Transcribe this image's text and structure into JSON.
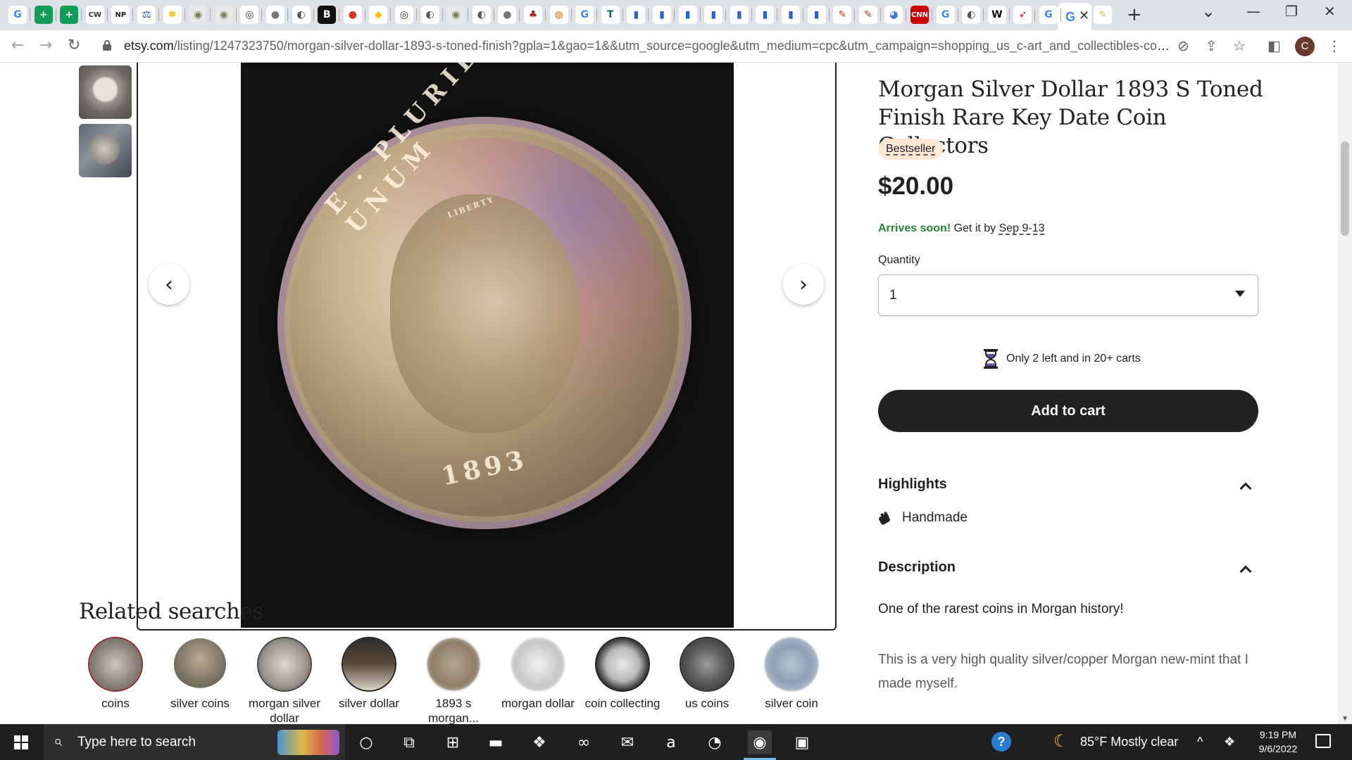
{
  "browser": {
    "favicons": [
      {
        "glyph": "G",
        "bg": "#ffffff",
        "fg": "#4285f4"
      },
      {
        "glyph": "+",
        "bg": "#0f9d58",
        "fg": "#ffffff"
      },
      {
        "glyph": "+",
        "bg": "#0f9d58",
        "fg": "#ffffff"
      },
      {
        "glyph": "CW",
        "bg": "#ffffff",
        "fg": "#333333"
      },
      {
        "glyph": "NP",
        "bg": "#ffffff",
        "fg": "#222222"
      },
      {
        "glyph": "⚖",
        "bg": "#ffffff",
        "fg": "#1a4fa0"
      },
      {
        "glyph": "✱",
        "bg": "#ffffff",
        "fg": "#ffc220"
      },
      {
        "glyph": "◉",
        "bg": "#e8e8e8",
        "fg": "#7a7a5a"
      },
      {
        "glyph": "◉",
        "bg": "#e8e8e8",
        "fg": "#7a7a5a"
      },
      {
        "glyph": "◎",
        "bg": "#ffffff",
        "fg": "#333333"
      },
      {
        "glyph": "●",
        "bg": "#ffffff",
        "fg": "#777777"
      },
      {
        "glyph": "◐",
        "bg": "#ffffff",
        "fg": "#555555"
      },
      {
        "glyph": "B",
        "bg": "#111111",
        "fg": "#ffffff"
      },
      {
        "glyph": "●",
        "bg": "#ffffff",
        "fg": "#d93025"
      },
      {
        "glyph": "◆",
        "bg": "#ffffff",
        "fg": "#f4c20d"
      },
      {
        "glyph": "◎",
        "bg": "#ffffff",
        "fg": "#333333"
      },
      {
        "glyph": "◐",
        "bg": "#ffffff",
        "fg": "#555555"
      },
      {
        "glyph": "◉",
        "bg": "#e8e8e8",
        "fg": "#7a7a5a"
      },
      {
        "glyph": "◐",
        "bg": "#ffffff",
        "fg": "#555555"
      },
      {
        "glyph": "●",
        "bg": "#ffffff",
        "fg": "#777777"
      },
      {
        "glyph": "♣",
        "bg": "#ffffff",
        "fg": "#b22222"
      },
      {
        "glyph": "◍",
        "bg": "#ffffff",
        "fg": "#e07b39"
      },
      {
        "glyph": "G",
        "bg": "#ffffff",
        "fg": "#4285f4"
      },
      {
        "glyph": "T",
        "bg": "#ffffff",
        "fg": "#0f6e5a"
      },
      {
        "glyph": "▮",
        "bg": "#ffffff",
        "fg": "#2b5fd9"
      },
      {
        "glyph": "▮",
        "bg": "#ffffff",
        "fg": "#2b5fd9"
      },
      {
        "glyph": "▮",
        "bg": "#ffffff",
        "fg": "#2b5fd9"
      },
      {
        "glyph": "▮",
        "bg": "#ffffff",
        "fg": "#2b5fd9"
      },
      {
        "glyph": "▮",
        "bg": "#ffffff",
        "fg": "#2b5fd9"
      },
      {
        "glyph": "▮",
        "bg": "#ffffff",
        "fg": "#2b5fd9"
      },
      {
        "glyph": "▮",
        "bg": "#ffffff",
        "fg": "#2b5fd9"
      },
      {
        "glyph": "▮",
        "bg": "#ffffff",
        "fg": "#2b5fd9"
      },
      {
        "glyph": "✎",
        "bg": "#ffffff",
        "fg": "#c0392b"
      },
      {
        "glyph": "✎",
        "bg": "#ffffff",
        "fg": "#c0392b"
      },
      {
        "glyph": "◕",
        "bg": "#ffffff",
        "fg": "#3a7bd5"
      },
      {
        "glyph": "CNN",
        "bg": "#cc0000",
        "fg": "#ffffff"
      },
      {
        "glyph": "G",
        "bg": "#ffffff",
        "fg": "#4285f4"
      },
      {
        "glyph": "◐",
        "bg": "#ffffff",
        "fg": "#555555"
      },
      {
        "glyph": "W",
        "bg": "#ffffff",
        "fg": "#111111"
      },
      {
        "glyph": "➶",
        "bg": "#ffffff",
        "fg": "#c41e3a"
      },
      {
        "glyph": "G",
        "bg": "#ffffff",
        "fg": "#4285f4"
      }
    ],
    "active_tab": {
      "glyph": "G",
      "close": "✕"
    },
    "after_tab": {
      "glyph": "✎",
      "fg": "#e0c060"
    },
    "new_tab": "+",
    "chevron": "⌄",
    "window_controls": {
      "minimize": "—",
      "restore": "❐",
      "close": "✕"
    },
    "nav": {
      "back": "←",
      "forward": "→",
      "reload": "↻"
    },
    "url": {
      "host": "etsy.com",
      "path": "/listing/1247323750/morgan-silver-dollar-1893-s-toned-finish?gpla=1&gao=1&&utm_source=google&utm_medium=cpc&utm_campaign=shopping_us_c-art_and_collectibles-colle..."
    },
    "toolbar_icons": {
      "eye_off": "⊘",
      "share": "⇪",
      "star": "☆",
      "sidebar": "◧",
      "menu": "⋮"
    },
    "profile_initial": "C"
  },
  "gallery": {
    "prev": "‹",
    "next": "›",
    "coin_legend": "E · PLURIBUS · UNUM",
    "coin_year": "1893",
    "coin_liberty": "LIBERTY"
  },
  "related": {
    "title": "Related searches",
    "items": [
      {
        "label": "coins",
        "bg": "radial-gradient(circle, #cfc7bd 0%, #7a716a 70%, #3a2c28 100%)",
        "ring": "#8b2e2e"
      },
      {
        "label": "silver coins",
        "bg": "radial-gradient(circle at 50% 40%, #b8ad96 0%, #6f6656 70%, #ffffff 72%)",
        "ring": "#ffffff"
      },
      {
        "label": "morgan silver dollar",
        "bg": "radial-gradient(circle, #ddd8d0 0%, #9b958c 60%, #3b3b3b 100%)",
        "ring": "#444444"
      },
      {
        "label": "silver dollar",
        "bg": "linear-gradient(180deg, #2a2a2a 0%, #5b4a3a 50%, #d9d3c6 100%)",
        "ring": "#222222"
      },
      {
        "label": "1893 s morgan...",
        "bg": "radial-gradient(circle, #b3a58e 0%, #8f7f68 60%, #e8e8e8 100%)",
        "ring": "#dddddd"
      },
      {
        "label": "morgan dollar",
        "bg": "radial-gradient(circle, #f2f2f2 0%, #c7c7c7 60%, #e9e9e9 100%)",
        "ring": "#e5e5e5"
      },
      {
        "label": "coin collecting",
        "bg": "radial-gradient(circle, #e8e8e8 0%, #b8b8b8 45%, #1d1d1d 75%)",
        "ring": "#1d1d1d"
      },
      {
        "label": "us coins",
        "bg": "radial-gradient(circle, #9d9d9d 0%, #5a5a5a 50%, #2a2a2a 100%)",
        "ring": "#2a2a2a"
      },
      {
        "label": "silver coin",
        "bg": "radial-gradient(circle, #b9c3cf 0%, #8ea0b5 50%, #c7d0da 100%)",
        "ring": "#c7d0da"
      }
    ]
  },
  "product": {
    "title": "Morgan Silver Dollar 1893 S Toned Finish Rare Key Date Coin Collectors",
    "badge": "Bestseller",
    "price": "$20.00",
    "arrives_soon": "Arrives soon!",
    "arrives_rest": " Get it by ",
    "arrives_date": "Sep 9-13",
    "quantity_label": "Quantity",
    "quantity_value": "1",
    "stock_text": "Only 2 left and in 20+ carts",
    "add_to_cart": "Add to cart",
    "highlights_heading": "Highlights",
    "highlight_item": "Handmade",
    "description_heading": "Description",
    "description_line1": "One of the rarest coins in Morgan history!",
    "description_line2": "This is a very high quality silver/copper Morgan new-mint that I made myself."
  },
  "taskbar": {
    "search_placeholder": "Type here to search",
    "apps": [
      {
        "name": "cortana",
        "glyph": "○"
      },
      {
        "name": "task-view",
        "glyph": "⧉"
      },
      {
        "name": "store",
        "glyph": "⊞"
      },
      {
        "name": "file-explorer",
        "glyph": "▬"
      },
      {
        "name": "dropbox",
        "glyph": "❖"
      },
      {
        "name": "infinity",
        "glyph": "∞"
      },
      {
        "name": "mail",
        "glyph": "✉"
      },
      {
        "name": "amazon",
        "glyph": "a"
      },
      {
        "name": "edge",
        "glyph": "◔"
      },
      {
        "name": "chrome",
        "glyph": "◉"
      },
      {
        "name": "photos",
        "glyph": "▣"
      }
    ],
    "help": "?",
    "weather": "85°F  Mostly clear",
    "tray_chevron": "^",
    "time": "9:19 PM",
    "date": "9/6/2022"
  }
}
